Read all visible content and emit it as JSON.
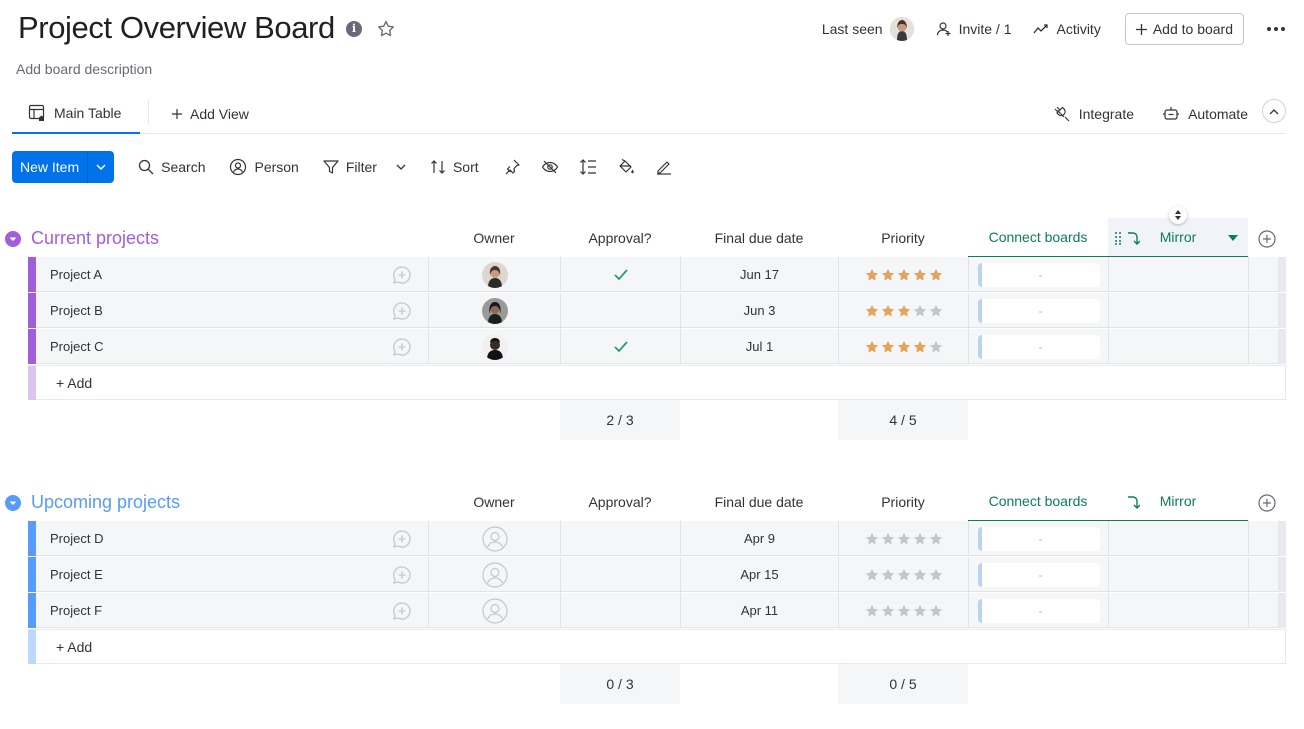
{
  "board": {
    "title": "Project Overview Board",
    "description": "Add board description"
  },
  "header": {
    "last_seen_label": "Last seen",
    "invite_label": "Invite / 1",
    "activity_label": "Activity",
    "add_to_board_label": "Add to board"
  },
  "views": {
    "main_table_label": "Main Table",
    "add_view_label": "Add View",
    "integrate_label": "Integrate",
    "automate_label": "Automate"
  },
  "toolbar": {
    "new_item_label": "New Item",
    "search_label": "Search",
    "person_label": "Person",
    "filter_label": "Filter",
    "sort_label": "Sort"
  },
  "columns": {
    "owner": "Owner",
    "approval": "Approval?",
    "due": "Final due date",
    "priority": "Priority",
    "connect": "Connect boards",
    "mirror": "Mirror"
  },
  "colors": {
    "primary": "#0073ea",
    "current_group": "#a25ddc",
    "upcoming_group": "#579bfc",
    "connect_green": "#0e7c5d",
    "star_filled": "#e2a45e",
    "star_empty": "#c5c7d0",
    "check": "#2d9a6b"
  },
  "groups": [
    {
      "title": "Current projects",
      "color": "#a25ddc",
      "add_color": "#dcc4f1",
      "items": [
        {
          "name": "Project A",
          "owner": "person-a",
          "approved": true,
          "due": "Jun 17",
          "priority": 5,
          "connect": "-"
        },
        {
          "name": "Project B",
          "owner": "person-b",
          "approved": false,
          "due": "Jun 3",
          "priority": 3,
          "connect": "-"
        },
        {
          "name": "Project C",
          "owner": "person-c",
          "approved": true,
          "due": "Jul 1",
          "priority": 4,
          "connect": "-"
        }
      ],
      "add_label": "+ Add",
      "approval_summary": "2 / 3",
      "priority_summary": "4 / 5"
    },
    {
      "title": "Upcoming projects",
      "color": "#579bfc",
      "add_color": "#bcd7fd",
      "items": [
        {
          "name": "Project D",
          "owner": null,
          "approved": false,
          "due": "Apr 9",
          "priority": 0,
          "connect": "-"
        },
        {
          "name": "Project E",
          "owner": null,
          "approved": false,
          "due": "Apr 15",
          "priority": 0,
          "connect": "-"
        },
        {
          "name": "Project F",
          "owner": null,
          "approved": false,
          "due": "Apr 11",
          "priority": 0,
          "connect": "-"
        }
      ],
      "add_label": "+ Add",
      "approval_summary": "0 / 3",
      "priority_summary": "0 / 5"
    }
  ]
}
